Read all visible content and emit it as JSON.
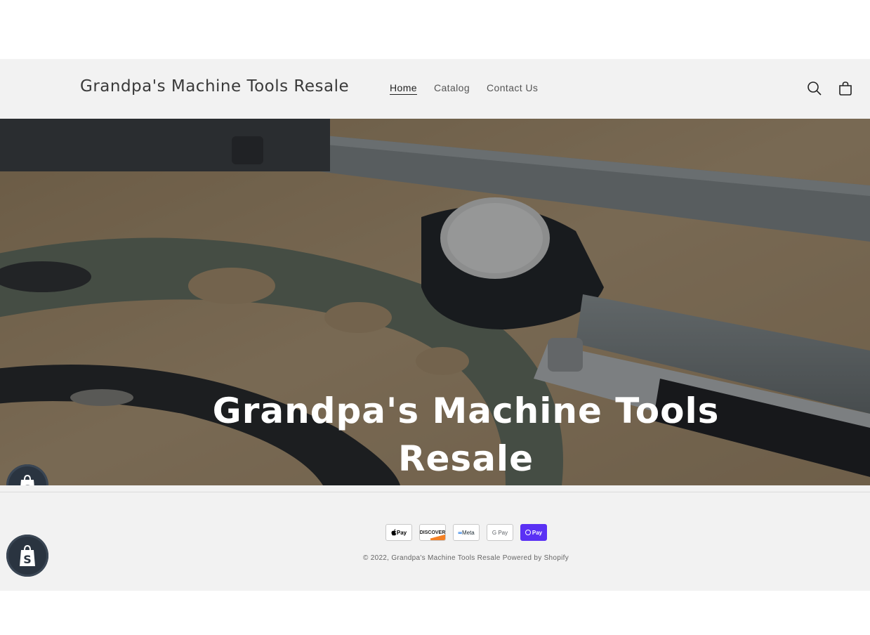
{
  "header": {
    "logo": "Grandpa's Machine Tools Resale",
    "nav": [
      {
        "label": "Home",
        "active": true
      },
      {
        "label": "Catalog",
        "active": false
      },
      {
        "label": "Contact Us",
        "active": false
      }
    ],
    "icons": [
      "search-icon",
      "cart-icon"
    ]
  },
  "hero": {
    "title": "Grandpa's Machine Tools Resale"
  },
  "footer": {
    "payment_methods": [
      {
        "name": "apple-pay-icon",
        "label": "Pay"
      },
      {
        "name": "discover-icon",
        "label": "DISCOVER"
      },
      {
        "name": "meta-pay-icon",
        "label": "Meta"
      },
      {
        "name": "google-pay-icon",
        "label": "G Pay"
      },
      {
        "name": "shop-pay-icon",
        "label": "Pay"
      }
    ],
    "copyright_prefix": "© 2022,",
    "copyright_store": "Grandpa's Machine Tools Resale",
    "powered_by": "Powered by Shopify"
  },
  "colors": {
    "header_bg": "#f2f2f2",
    "hero_overlay": "#14161c",
    "shop_pay": "#5a31f4",
    "shopify_badge": "#2a3440"
  }
}
